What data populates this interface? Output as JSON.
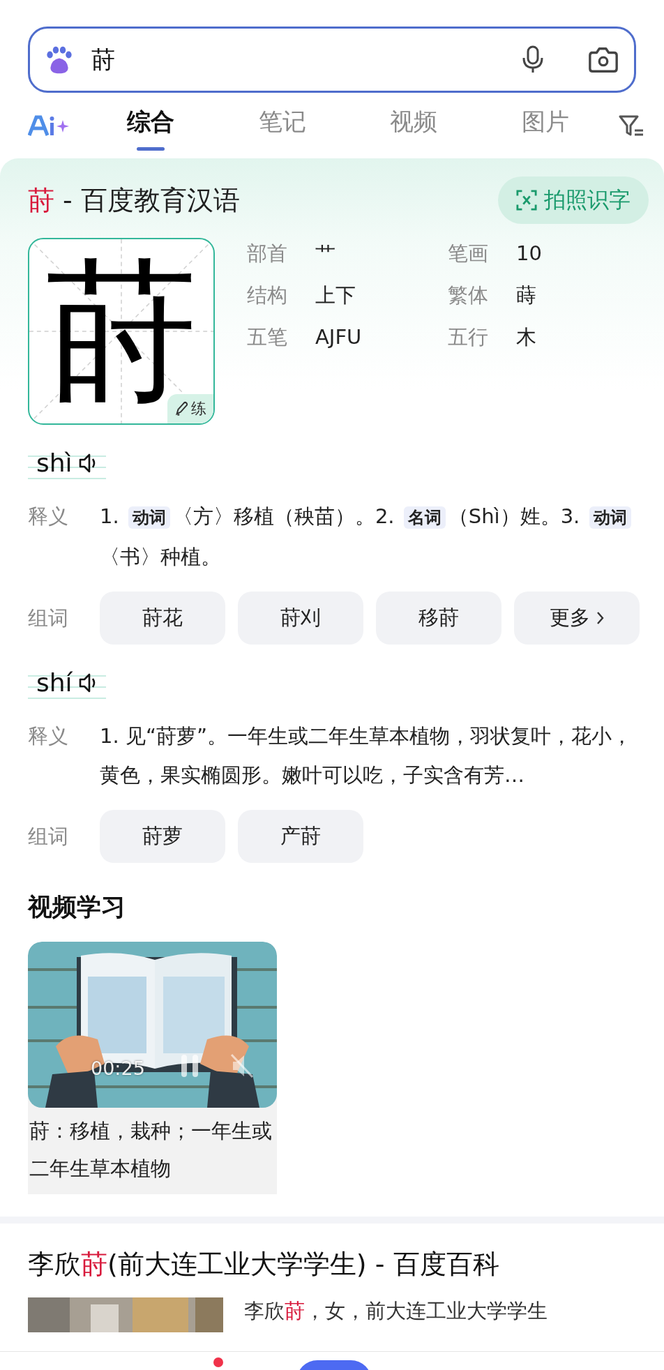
{
  "search": {
    "value": "莳"
  },
  "tabs": [
    {
      "label": "综合",
      "selected": true
    },
    {
      "label": "笔记",
      "selected": false
    },
    {
      "label": "视频",
      "selected": false
    },
    {
      "label": "图片",
      "selected": false
    }
  ],
  "dictionary": {
    "title": [
      {
        "text": "莳",
        "highlight": true
      },
      {
        "text": " - 百度教育汉语",
        "highlight": false
      }
    ],
    "photo_button": "拍照识字",
    "character": "莳",
    "practice_button": "练",
    "attributes": [
      {
        "label": "部首",
        "value": "艹"
      },
      {
        "label": "笔画",
        "value": "10"
      },
      {
        "label": "结构",
        "value": "上下"
      },
      {
        "label": "繁体",
        "value": "蒔"
      },
      {
        "label": "五笔",
        "value": "AJFU"
      },
      {
        "label": "五行",
        "value": "木"
      }
    ],
    "readings": [
      {
        "pinyin": "shì",
        "definition_label": "释义",
        "definition": [
          {
            "kind": "text",
            "text": "1. "
          },
          {
            "kind": "tag",
            "text": "动词"
          },
          {
            "kind": "text",
            "text": "〈方〉移植（秧苗）。2. "
          },
          {
            "kind": "tag",
            "text": "名词"
          },
          {
            "kind": "text",
            "text": "（Shì）姓。3. "
          },
          {
            "kind": "tag",
            "text": "动词"
          },
          {
            "kind": "text",
            "text": "〈书〉种植。"
          }
        ],
        "words_label": "组词",
        "words": [
          {
            "kind": "word",
            "text": "莳花"
          },
          {
            "kind": "word",
            "text": "莳刈"
          },
          {
            "kind": "word",
            "text": "移莳"
          },
          {
            "kind": "more",
            "text": "更多"
          }
        ]
      },
      {
        "pinyin": "shí",
        "definition_label": "释义",
        "definition": [
          {
            "kind": "text",
            "text": "1. 见“莳萝”。一年生或二年生草本植物，羽状复叶，花小，黄色，果实椭圆形。嫩叶可以吃，子实含有芳…"
          }
        ],
        "words_label": "组词",
        "words": [
          {
            "kind": "word",
            "text": "莳萝"
          },
          {
            "kind": "word",
            "text": "产莳"
          }
        ]
      }
    ]
  },
  "video_section": {
    "title": "视频学习",
    "videos": [
      {
        "kind": "picture",
        "time": "00:25",
        "caption": "莳：移植，栽种；一年生或二年生草本植物"
      }
    ]
  },
  "results": [
    {
      "title": [
        {
          "text": "李欣",
          "highlight": false
        },
        {
          "text": "莳",
          "highlight": true
        },
        {
          "text": "(前大连工业大学学生) - 百度百科",
          "highlight": false
        }
      ],
      "snippet": [
        {
          "text": "李欣",
          "highlight": false
        },
        {
          "text": "莳",
          "highlight": true
        },
        {
          "text": "，女，前大连工业大学学生",
          "highlight": false
        }
      ]
    }
  ]
}
